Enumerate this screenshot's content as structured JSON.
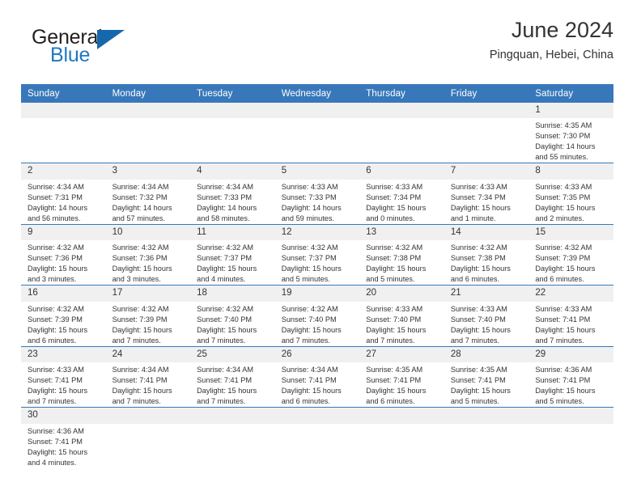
{
  "brand": {
    "name_part1": "General",
    "name_part2": "Blue",
    "logo_icon": "triangle-flag-icon"
  },
  "header": {
    "month_title": "June 2024",
    "location": "Pingquan, Hebei, China"
  },
  "colors": {
    "header_blue": "#3878ba",
    "brand_blue": "#1f78c1",
    "daynum_bg": "#f0f0f0",
    "text": "#333333"
  },
  "weekday_headers": [
    "Sunday",
    "Monday",
    "Tuesday",
    "Wednesday",
    "Thursday",
    "Friday",
    "Saturday"
  ],
  "weeks": [
    [
      {
        "day": "",
        "sunrise": "",
        "sunset": "",
        "daylight1": "",
        "daylight2": "",
        "empty": true
      },
      {
        "day": "",
        "sunrise": "",
        "sunset": "",
        "daylight1": "",
        "daylight2": "",
        "empty": true
      },
      {
        "day": "",
        "sunrise": "",
        "sunset": "",
        "daylight1": "",
        "daylight2": "",
        "empty": true
      },
      {
        "day": "",
        "sunrise": "",
        "sunset": "",
        "daylight1": "",
        "daylight2": "",
        "empty": true
      },
      {
        "day": "",
        "sunrise": "",
        "sunset": "",
        "daylight1": "",
        "daylight2": "",
        "empty": true
      },
      {
        "day": "",
        "sunrise": "",
        "sunset": "",
        "daylight1": "",
        "daylight2": "",
        "empty": true
      },
      {
        "day": "1",
        "sunrise": "Sunrise: 4:35 AM",
        "sunset": "Sunset: 7:30 PM",
        "daylight1": "Daylight: 14 hours",
        "daylight2": "and 55 minutes.",
        "empty": false
      }
    ],
    [
      {
        "day": "2",
        "sunrise": "Sunrise: 4:34 AM",
        "sunset": "Sunset: 7:31 PM",
        "daylight1": "Daylight: 14 hours",
        "daylight2": "and 56 minutes.",
        "empty": false
      },
      {
        "day": "3",
        "sunrise": "Sunrise: 4:34 AM",
        "sunset": "Sunset: 7:32 PM",
        "daylight1": "Daylight: 14 hours",
        "daylight2": "and 57 minutes.",
        "empty": false
      },
      {
        "day": "4",
        "sunrise": "Sunrise: 4:34 AM",
        "sunset": "Sunset: 7:33 PM",
        "daylight1": "Daylight: 14 hours",
        "daylight2": "and 58 minutes.",
        "empty": false
      },
      {
        "day": "5",
        "sunrise": "Sunrise: 4:33 AM",
        "sunset": "Sunset: 7:33 PM",
        "daylight1": "Daylight: 14 hours",
        "daylight2": "and 59 minutes.",
        "empty": false
      },
      {
        "day": "6",
        "sunrise": "Sunrise: 4:33 AM",
        "sunset": "Sunset: 7:34 PM",
        "daylight1": "Daylight: 15 hours",
        "daylight2": "and 0 minutes.",
        "empty": false
      },
      {
        "day": "7",
        "sunrise": "Sunrise: 4:33 AM",
        "sunset": "Sunset: 7:34 PM",
        "daylight1": "Daylight: 15 hours",
        "daylight2": "and 1 minute.",
        "empty": false
      },
      {
        "day": "8",
        "sunrise": "Sunrise: 4:33 AM",
        "sunset": "Sunset: 7:35 PM",
        "daylight1": "Daylight: 15 hours",
        "daylight2": "and 2 minutes.",
        "empty": false
      }
    ],
    [
      {
        "day": "9",
        "sunrise": "Sunrise: 4:32 AM",
        "sunset": "Sunset: 7:36 PM",
        "daylight1": "Daylight: 15 hours",
        "daylight2": "and 3 minutes.",
        "empty": false
      },
      {
        "day": "10",
        "sunrise": "Sunrise: 4:32 AM",
        "sunset": "Sunset: 7:36 PM",
        "daylight1": "Daylight: 15 hours",
        "daylight2": "and 3 minutes.",
        "empty": false
      },
      {
        "day": "11",
        "sunrise": "Sunrise: 4:32 AM",
        "sunset": "Sunset: 7:37 PM",
        "daylight1": "Daylight: 15 hours",
        "daylight2": "and 4 minutes.",
        "empty": false
      },
      {
        "day": "12",
        "sunrise": "Sunrise: 4:32 AM",
        "sunset": "Sunset: 7:37 PM",
        "daylight1": "Daylight: 15 hours",
        "daylight2": "and 5 minutes.",
        "empty": false
      },
      {
        "day": "13",
        "sunrise": "Sunrise: 4:32 AM",
        "sunset": "Sunset: 7:38 PM",
        "daylight1": "Daylight: 15 hours",
        "daylight2": "and 5 minutes.",
        "empty": false
      },
      {
        "day": "14",
        "sunrise": "Sunrise: 4:32 AM",
        "sunset": "Sunset: 7:38 PM",
        "daylight1": "Daylight: 15 hours",
        "daylight2": "and 6 minutes.",
        "empty": false
      },
      {
        "day": "15",
        "sunrise": "Sunrise: 4:32 AM",
        "sunset": "Sunset: 7:39 PM",
        "daylight1": "Daylight: 15 hours",
        "daylight2": "and 6 minutes.",
        "empty": false
      }
    ],
    [
      {
        "day": "16",
        "sunrise": "Sunrise: 4:32 AM",
        "sunset": "Sunset: 7:39 PM",
        "daylight1": "Daylight: 15 hours",
        "daylight2": "and 6 minutes.",
        "empty": false
      },
      {
        "day": "17",
        "sunrise": "Sunrise: 4:32 AM",
        "sunset": "Sunset: 7:39 PM",
        "daylight1": "Daylight: 15 hours",
        "daylight2": "and 7 minutes.",
        "empty": false
      },
      {
        "day": "18",
        "sunrise": "Sunrise: 4:32 AM",
        "sunset": "Sunset: 7:40 PM",
        "daylight1": "Daylight: 15 hours",
        "daylight2": "and 7 minutes.",
        "empty": false
      },
      {
        "day": "19",
        "sunrise": "Sunrise: 4:32 AM",
        "sunset": "Sunset: 7:40 PM",
        "daylight1": "Daylight: 15 hours",
        "daylight2": "and 7 minutes.",
        "empty": false
      },
      {
        "day": "20",
        "sunrise": "Sunrise: 4:33 AM",
        "sunset": "Sunset: 7:40 PM",
        "daylight1": "Daylight: 15 hours",
        "daylight2": "and 7 minutes.",
        "empty": false
      },
      {
        "day": "21",
        "sunrise": "Sunrise: 4:33 AM",
        "sunset": "Sunset: 7:40 PM",
        "daylight1": "Daylight: 15 hours",
        "daylight2": "and 7 minutes.",
        "empty": false
      },
      {
        "day": "22",
        "sunrise": "Sunrise: 4:33 AM",
        "sunset": "Sunset: 7:41 PM",
        "daylight1": "Daylight: 15 hours",
        "daylight2": "and 7 minutes.",
        "empty": false
      }
    ],
    [
      {
        "day": "23",
        "sunrise": "Sunrise: 4:33 AM",
        "sunset": "Sunset: 7:41 PM",
        "daylight1": "Daylight: 15 hours",
        "daylight2": "and 7 minutes.",
        "empty": false
      },
      {
        "day": "24",
        "sunrise": "Sunrise: 4:34 AM",
        "sunset": "Sunset: 7:41 PM",
        "daylight1": "Daylight: 15 hours",
        "daylight2": "and 7 minutes.",
        "empty": false
      },
      {
        "day": "25",
        "sunrise": "Sunrise: 4:34 AM",
        "sunset": "Sunset: 7:41 PM",
        "daylight1": "Daylight: 15 hours",
        "daylight2": "and 7 minutes.",
        "empty": false
      },
      {
        "day": "26",
        "sunrise": "Sunrise: 4:34 AM",
        "sunset": "Sunset: 7:41 PM",
        "daylight1": "Daylight: 15 hours",
        "daylight2": "and 6 minutes.",
        "empty": false
      },
      {
        "day": "27",
        "sunrise": "Sunrise: 4:35 AM",
        "sunset": "Sunset: 7:41 PM",
        "daylight1": "Daylight: 15 hours",
        "daylight2": "and 6 minutes.",
        "empty": false
      },
      {
        "day": "28",
        "sunrise": "Sunrise: 4:35 AM",
        "sunset": "Sunset: 7:41 PM",
        "daylight1": "Daylight: 15 hours",
        "daylight2": "and 5 minutes.",
        "empty": false
      },
      {
        "day": "29",
        "sunrise": "Sunrise: 4:36 AM",
        "sunset": "Sunset: 7:41 PM",
        "daylight1": "Daylight: 15 hours",
        "daylight2": "and 5 minutes.",
        "empty": false
      }
    ],
    [
      {
        "day": "30",
        "sunrise": "Sunrise: 4:36 AM",
        "sunset": "Sunset: 7:41 PM",
        "daylight1": "Daylight: 15 hours",
        "daylight2": "and 4 minutes.",
        "empty": false
      },
      {
        "day": "",
        "sunrise": "",
        "sunset": "",
        "daylight1": "",
        "daylight2": "",
        "empty": true
      },
      {
        "day": "",
        "sunrise": "",
        "sunset": "",
        "daylight1": "",
        "daylight2": "",
        "empty": true
      },
      {
        "day": "",
        "sunrise": "",
        "sunset": "",
        "daylight1": "",
        "daylight2": "",
        "empty": true
      },
      {
        "day": "",
        "sunrise": "",
        "sunset": "",
        "daylight1": "",
        "daylight2": "",
        "empty": true
      },
      {
        "day": "",
        "sunrise": "",
        "sunset": "",
        "daylight1": "",
        "daylight2": "",
        "empty": true
      },
      {
        "day": "",
        "sunrise": "",
        "sunset": "",
        "daylight1": "",
        "daylight2": "",
        "empty": true
      }
    ]
  ]
}
